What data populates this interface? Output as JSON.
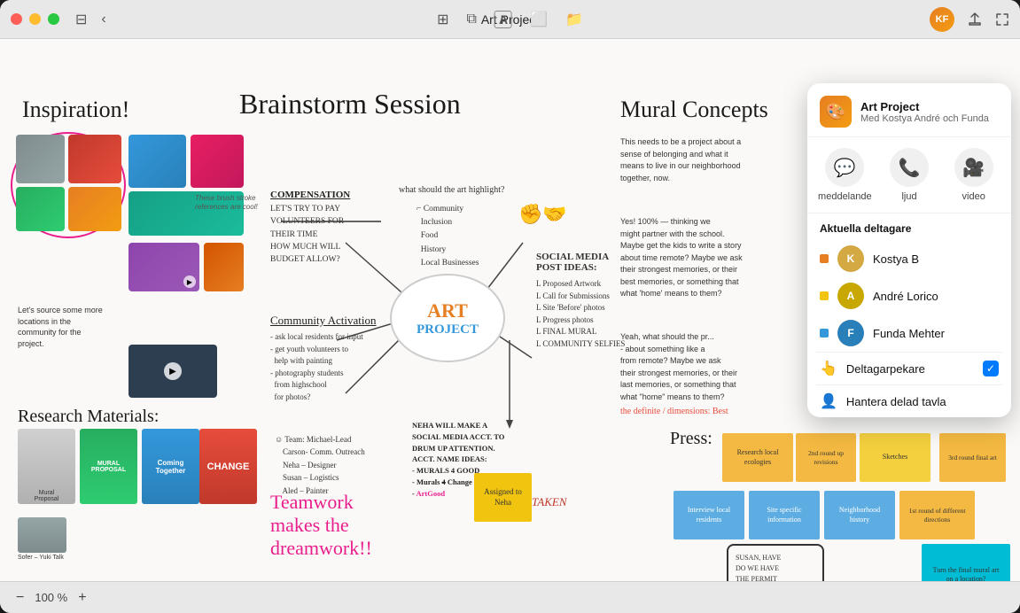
{
  "window": {
    "title": "Art Project"
  },
  "titlebar": {
    "back_label": "‹",
    "title": "Art Project",
    "traffic_lights": [
      "●",
      "●",
      "●"
    ]
  },
  "toolbar": {
    "center_icons": [
      "grid",
      "copy",
      "text",
      "image",
      "folder"
    ],
    "right_icons": [
      "share",
      "fullscreen"
    ]
  },
  "bottombar": {
    "zoom_out": "−",
    "zoom_level": "100 %",
    "zoom_in": "+"
  },
  "canvas": {
    "sections": {
      "inspiration": "Inspiration!",
      "brainstorm": "Brainstorm Session",
      "mural": "Mural Concepts",
      "research": "Research Materials:",
      "press": "Press:"
    },
    "brainstorm_center": "ART\nPROJECT",
    "teamwork": "Teamwork\nmakes the\ndreamwork!!",
    "compensation_header": "COMPENSATION",
    "compensation_text": "LET'S TRY TO PAY\nVOLUNTEERS FOR\nTHEIR TIME\nHOW MUCH WILL\nBUDGET ALLOW?",
    "community_activation": "Community Activation",
    "community_text": "- ask local residents for input\n- get youth volunteers to\nhelp with painting\n- photography students\nfrom highschool\nfor photos?",
    "team_label": "Team: Michael-Lead\nCarson- Comm. Outreach\nNeha - Designer\nSusan - Logistics\nAled - Painter",
    "social_media": "SOCIAL MEDIA\nPOST IDEAS:",
    "social_ideas": "Proposed Artwork\nCall for Submissions\nSite 'Before' photos\nProgress photos\nFINAL MURAL\nCOMMUNITY SELFIES",
    "what_highlight": "what should the art highlight?",
    "highlights": "Community\nInclusion\nFood\nHistory\nLocal Businesses",
    "neha_note": "NEHA WILL MAKE A\nSOCIAL MEDIA ACCT. TO\nDRUM UP ATTENTION.\nACCT. NAME IDEAS:\n- MURALS 4 GOOD\n- Murals 4 Change\n- ArtGood",
    "taken_label": "TAKEN",
    "assigned_sticky": "Assigned to\nNeha",
    "sticky_notes": [
      {
        "text": "Research local\necologies",
        "color": "#f4b942"
      },
      {
        "text": "Sketches",
        "color": "#f4d03f"
      },
      {
        "text": "Interview\nlocal residents",
        "color": "#5dade2"
      },
      {
        "text": "Site specific\ninformation",
        "color": "#5dade2"
      },
      {
        "text": "Neighborhood\nhistory",
        "color": "#5dade2"
      },
      {
        "text": "1st round of\ndifferent\ndirections",
        "color": "#f4b942"
      },
      {
        "text": "2nd round up\nrevisions",
        "color": "#f4b942"
      },
      {
        "text": "3rd round\nfinal art",
        "color": "#f4b942"
      }
    ],
    "susan_note": "SUSAN, HAVE\nDO WE HAVE\nTHE PERMIT\nPAPERWORK?",
    "turn_final": "Turn the final\nmural art on a\nlocation?",
    "source_note": "Let's source some\nmore locations in\nthe community for\nthe project.",
    "brush_strokes": "These brush\nstroke references\nare cool!",
    "dimensions": "the definite / dimensions: Best"
  },
  "collab_panel": {
    "title": "Art Project",
    "subtitle": "Med Kostya André och Funda",
    "actions": [
      {
        "label": "meddelande",
        "icon": "💬"
      },
      {
        "label": "ljud",
        "icon": "📞"
      },
      {
        "label": "video",
        "icon": "🎥"
      }
    ],
    "section_title": "Aktuella deltagare",
    "participants": [
      {
        "name": "Kostya B",
        "color": "#e67e22",
        "initials": "K"
      },
      {
        "name": "André Lorico",
        "color": "#f1c40f",
        "initials": "A"
      },
      {
        "name": "Funda Mehter",
        "color": "#3498db",
        "initials": "F"
      }
    ],
    "toggle_participant": "Deltagarpekare",
    "toggle_shared": "Hantera delad tavla",
    "toggle_checked": true
  }
}
